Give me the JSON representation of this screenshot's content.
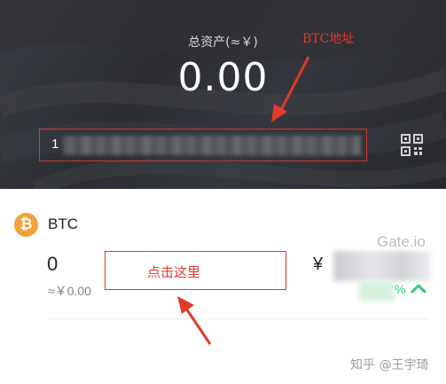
{
  "header": {
    "total_assets_label": "总资产(≈￥)",
    "total_assets_value": "0.00",
    "address_prefix": "1"
  },
  "annotations": {
    "btc_address": "BTC地址",
    "click_here": "点击这里"
  },
  "coin": {
    "icon_symbol": "₿",
    "name": "BTC",
    "balance": "0",
    "balance_cny": "≈￥0.00",
    "price_symbol": "¥",
    "change_symbol": "%"
  },
  "watermarks": {
    "gate": "Gate.io",
    "zhihu": "知乎 @王宇琦"
  },
  "colors": {
    "annotation_red": "#e03a2a",
    "btc_orange": "#f0a13a",
    "up_green": "#2ec97a",
    "header_bg": "#2f3137"
  },
  "icons": [
    "qr-code-icon",
    "bitcoin-icon",
    "chevron-up-icon"
  ]
}
